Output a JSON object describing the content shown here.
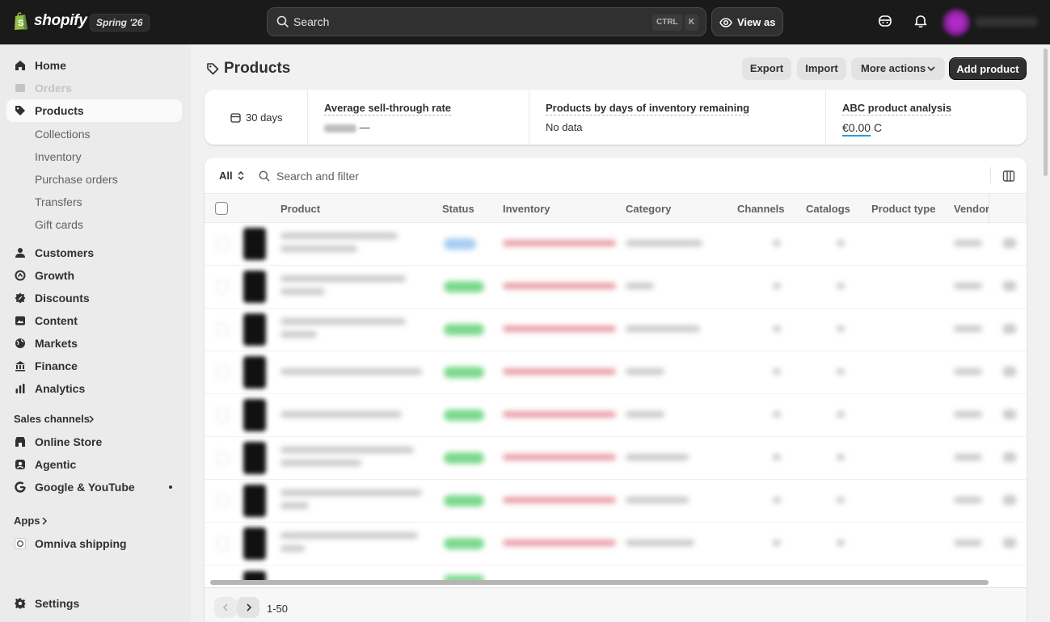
{
  "topbar": {
    "brand": "shopify",
    "edition": "Spring '26",
    "search_placeholder": "Search",
    "shortcut_ctrl": "CTRL",
    "shortcut_key": "K",
    "view_as": "View as"
  },
  "sidebar": {
    "items": [
      {
        "label": "Home",
        "icon": "home-icon"
      },
      {
        "label": "Orders",
        "icon": "orders-icon"
      },
      {
        "label": "Products",
        "icon": "tag-icon"
      },
      {
        "label": "Customers",
        "icon": "person-icon"
      },
      {
        "label": "Growth",
        "icon": "growth-icon"
      },
      {
        "label": "Discounts",
        "icon": "discount-icon"
      },
      {
        "label": "Content",
        "icon": "content-icon"
      },
      {
        "label": "Markets",
        "icon": "globe-icon"
      },
      {
        "label": "Finance",
        "icon": "bank-icon"
      },
      {
        "label": "Analytics",
        "icon": "bar-chart-icon"
      }
    ],
    "product_subitems": [
      "Collections",
      "Inventory",
      "Purchase orders",
      "Transfers",
      "Gift cards"
    ],
    "sales_channels_label": "Sales channels",
    "channels": [
      {
        "label": "Online Store",
        "icon": "store-icon"
      },
      {
        "label": "Agentic",
        "icon": "agentic-icon"
      },
      {
        "label": "Google & YouTube",
        "icon": "google-icon"
      }
    ],
    "apps_label": "Apps",
    "apps": [
      {
        "label": "Omniva shipping",
        "icon": "omniva-icon"
      }
    ],
    "settings_label": "Settings"
  },
  "page": {
    "title": "Products",
    "actions": {
      "export": "Export",
      "import": "Import",
      "more": "More actions",
      "add": "Add product"
    }
  },
  "metrics": {
    "range": "30 days",
    "sell_through": {
      "title": "Average sell-through rate",
      "value": "—"
    },
    "inventory_days": {
      "title": "Products by days of inventory remaining",
      "value": "No data"
    },
    "abc": {
      "title": "ABC product analysis",
      "value": "€0.00",
      "suffix": "C"
    }
  },
  "table": {
    "tab": "All",
    "search_placeholder": "Search and filter",
    "columns": [
      "Product",
      "Status",
      "Inventory",
      "Category",
      "Channels",
      "Catalogs",
      "Product type",
      "Vendor"
    ],
    "pagination": "1-50"
  },
  "colors": {
    "topbar": "#1a1a1a",
    "status_active": "#7ad88c",
    "status_draft": "#a8cdf2",
    "out_of_stock": "#e8a0a8"
  }
}
